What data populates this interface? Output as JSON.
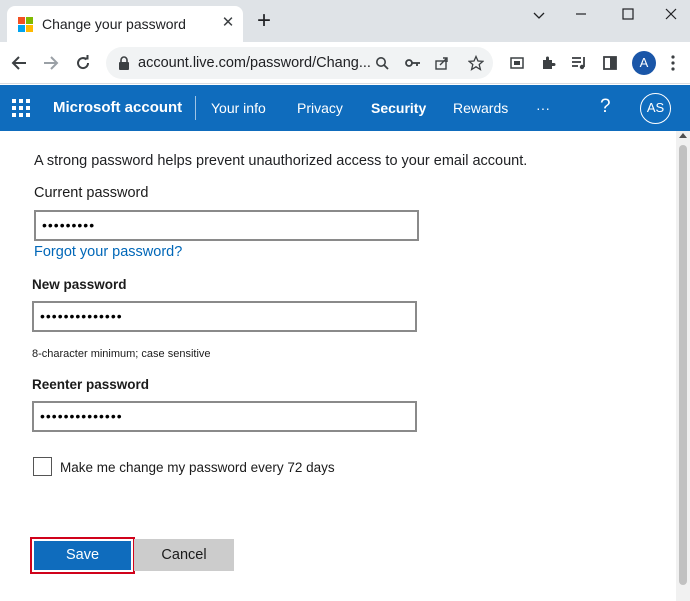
{
  "browser": {
    "tab_title": "Change your password",
    "tab_close": "✕",
    "new_tab": "+",
    "url": "account.live.com/password/Chang...",
    "profile_initial": "A"
  },
  "msnav": {
    "brand": "Microsoft account",
    "links": [
      "Your info",
      "Privacy",
      "Security",
      "Rewards",
      "···"
    ],
    "active": "Security",
    "help": "?",
    "avatar": "AS"
  },
  "form": {
    "intro": "A strong password helps prevent unauthorized access to your email account.",
    "current_label": "Current password",
    "current_value": "•••••••••",
    "forgot_link": "Forgot your password?",
    "new_label": "New password",
    "new_value": "••••••••••••••",
    "new_hint": "8-character minimum; case sensitive",
    "reenter_label": "Reenter password",
    "reenter_value": "••••••••••••••",
    "checkbox_label": "Make me change my password every 72 days",
    "checkbox_checked": false,
    "save_label": "Save",
    "cancel_label": "Cancel"
  },
  "colors": {
    "nav_blue": "#0f6cbd",
    "link_blue": "#0067b8",
    "highlight_red": "#d0021b"
  }
}
